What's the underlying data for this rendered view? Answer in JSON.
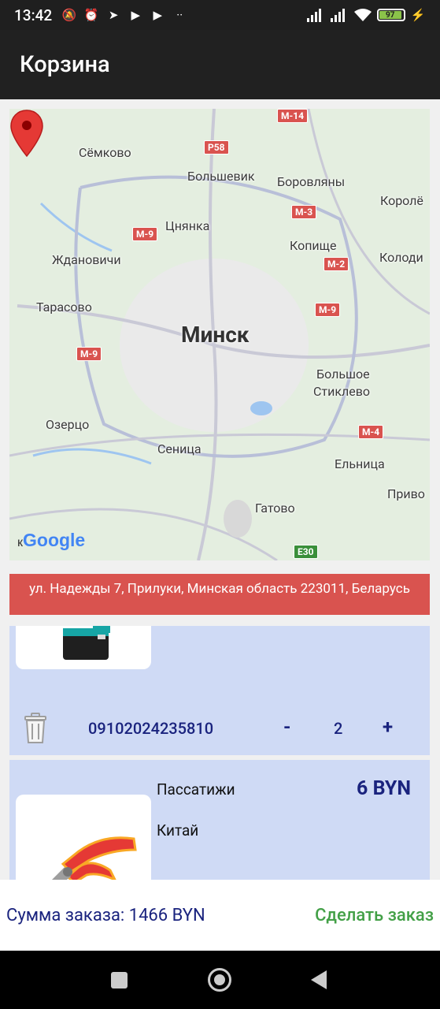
{
  "status_bar": {
    "time": "13:42",
    "battery": "97",
    "icons": [
      "mute-icon",
      "alarm-icon",
      "telegram-icon",
      "youtube-icon",
      "youtube-icon",
      "more-icon",
      "signal-icon",
      "signal-icon",
      "wifi-icon",
      "battery-icon",
      "charging-icon"
    ]
  },
  "app_bar": {
    "title": "Корзина"
  },
  "map": {
    "city": "Минск",
    "labels": [
      "Сёмково",
      "Большевик",
      "Боровляны",
      "Королё",
      "Цнянка",
      "Ждановичи",
      "Копище",
      "Колоди",
      "Тарасово",
      "Большое",
      "Стиклево",
      "Озерцо",
      "Сеница",
      "Ельница",
      "Гатово",
      "Приво"
    ],
    "roads": [
      "М-14",
      "Р58",
      "М-3",
      "М-9",
      "М-2",
      "М-9",
      "М-9",
      "М-4",
      "E30"
    ],
    "logo": "Google",
    "logo_prefix": "к"
  },
  "address": "ул. Надежды 7, Прилуки, Минская область 223011, Беларусь",
  "cart": {
    "items": [
      {
        "sku": "09102024235810",
        "minus": "-",
        "quantity": "2",
        "plus": "+"
      },
      {
        "name": "Пассатижи",
        "origin": "Китай",
        "price": "6 BYN"
      }
    ]
  },
  "footer": {
    "sum_label": "Сумма заказа: 1466 BYN",
    "order_button": "Сделать заказ"
  },
  "colors": {
    "app_bar": "#212121",
    "address_bar": "#d9534f",
    "item_bg": "#cfdaf5",
    "accent_text": "#1a237e",
    "order_button": "#43a047"
  }
}
